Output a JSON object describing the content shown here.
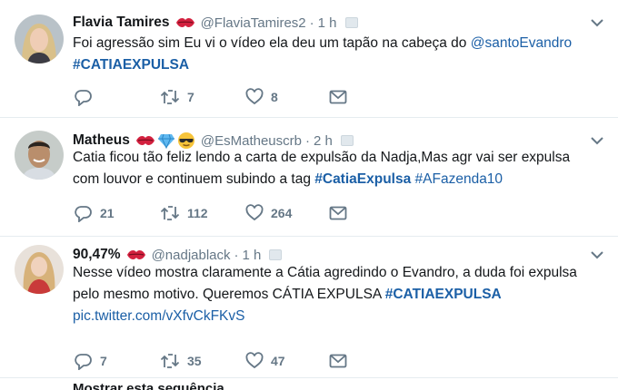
{
  "tweets": [
    {
      "name": "Flavia Tamires",
      "handle": "@FlaviaTamires2",
      "dot": "·",
      "time": "1 h",
      "text_parts": [
        {
          "t": "Foi agressão sim Eu vi o vídeo ela deu um tapão na cabeça do ",
          "k": "plain"
        },
        {
          "t": "@santoEvandro",
          "k": "link"
        },
        {
          "t": "\n",
          "k": "br"
        },
        {
          "t": "#CATIAEXPULSA",
          "k": "tag"
        }
      ],
      "reply_count": "",
      "retweet_count": "7",
      "like_count": "8"
    },
    {
      "name": "Matheus",
      "handle": "@EsMatheuscrb",
      "dot": "·",
      "time": "2 h",
      "text_parts": [
        {
          "t": "Catia ficou tão feliz lendo a carta de expulsão da Nadja,Mas agr vai ser expulsa",
          "k": "plain"
        },
        {
          "t": "\n",
          "k": "br"
        },
        {
          "t": "com louvor e continuem subindo a tag ",
          "k": "plain"
        },
        {
          "t": "#CatiaExpulsa",
          "k": "tag"
        },
        {
          "t": " ",
          "k": "plain"
        },
        {
          "t": "#AFazenda10",
          "k": "link"
        }
      ],
      "reply_count": "21",
      "retweet_count": "112",
      "like_count": "264"
    },
    {
      "name": "90,47%",
      "handle": "@nadjablack",
      "dot": "·",
      "time": "1 h",
      "text_parts": [
        {
          "t": "Nesse vídeo mostra claramente a Cátia agredindo o Evandro, a duda foi expulsa",
          "k": "plain"
        },
        {
          "t": "\n",
          "k": "br"
        },
        {
          "t": "pelo mesmo motivo. Queremos CÁTIA EXPULSA ",
          "k": "plain"
        },
        {
          "t": "#CATIAEXPULSA",
          "k": "tag"
        },
        {
          "t": "\n",
          "k": "br"
        },
        {
          "t": "pic.twitter.com/vXfvCkFKvS",
          "k": "link"
        }
      ],
      "reply_count": "7",
      "retweet_count": "35",
      "like_count": "47"
    }
  ],
  "partial_next_tweet": "Mostrar esta sequência",
  "colors": {
    "link": "#1b5fa6",
    "muted": "#657786",
    "heart_emoji": "#d3213f",
    "divider": "#e6ecf0"
  },
  "icons": [
    "reply-icon",
    "retweet-icon",
    "like-icon",
    "dm-icon",
    "chevron-down-icon",
    "kiss-emoji-icon",
    "gem-emoji-icon",
    "sunglasses-emoji-icon"
  ]
}
